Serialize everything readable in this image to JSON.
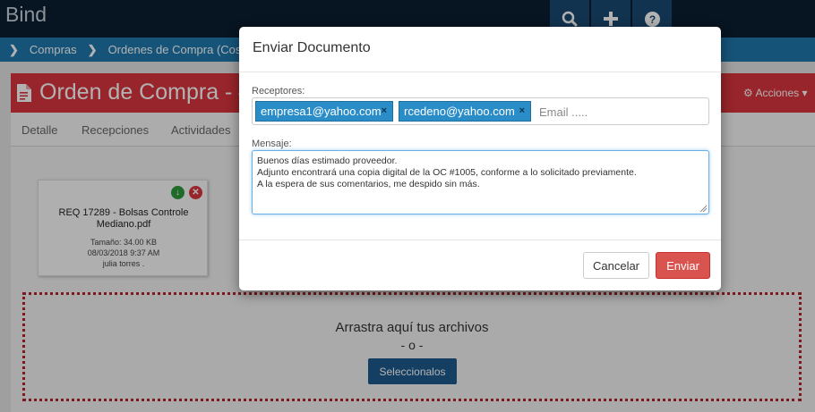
{
  "app": {
    "brand": "Bind"
  },
  "topbar": {
    "icons": [
      "search-icon",
      "plus-icon",
      "question-icon"
    ]
  },
  "breadcrumb": {
    "items": [
      "Compras",
      "Ordenes de Compra (Costo"
    ]
  },
  "page": {
    "title": "Orden de Compra - #",
    "actions_label": "Acciones"
  },
  "tabs": [
    "Detalle",
    "Recepciones",
    "Actividades"
  ],
  "file_card": {
    "name_line1": "REQ 17289 - Bolsas Controle",
    "name_line2": "Mediano.pdf",
    "size": "Tamaño: 34.00 KB",
    "date": "08/03/2018 9:37 AM",
    "user": "julia torres ."
  },
  "dropzone": {
    "text": "Arrastra aquí tus archivos",
    "or": "- o -",
    "button": "Seleccionalos"
  },
  "modal": {
    "title": "Enviar Documento",
    "recipients_label": "Receptores:",
    "recipients": [
      "empresa1@yahoo.com",
      "rcedeno@yahoo.com"
    ],
    "email_placeholder": "Email .....",
    "message_label": "Mensaje:",
    "message_lines": [
      "Buenos días estimado proveedor.",
      "Adjunto encontrará una copia digital de la OC #1005, conforme a lo solicitado previamente.",
      "A la espera de sus comentarios, me despido sin más."
    ],
    "cancel_label": "Cancelar",
    "send_label": "Enviar"
  },
  "colors": {
    "navbar": "#0b1e30",
    "breadcrumb": "#1f79ad",
    "header_red": "#d9363e",
    "tag_blue": "#2a8dc7",
    "send_red": "#d9534f"
  }
}
